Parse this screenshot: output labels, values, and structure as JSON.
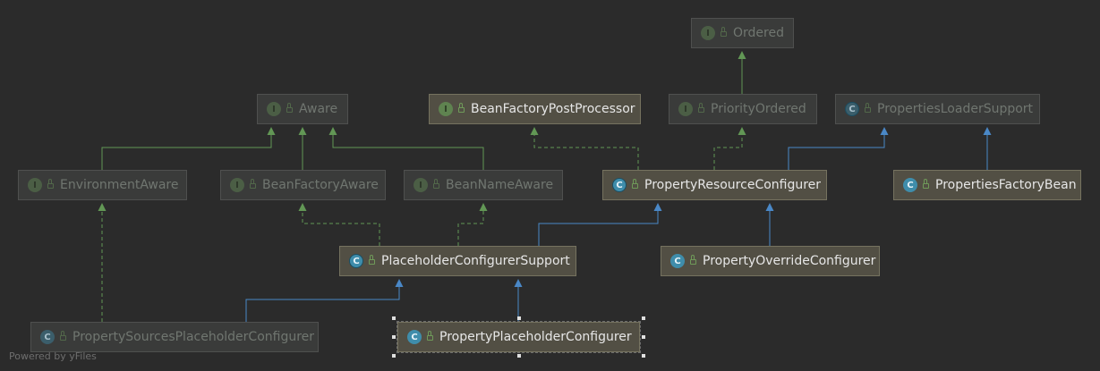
{
  "colors": {
    "background": "#2b2b2b",
    "implements_edge": "#629755",
    "extends_edge": "#4a88c7",
    "selection_handle": "#e0e0e0"
  },
  "nodes": {
    "ordered": {
      "name": "Ordered",
      "kind": "interface",
      "dim": true
    },
    "aware": {
      "name": "Aware",
      "kind": "interface",
      "dim": true
    },
    "bean_factory_post_processor": {
      "name": "BeanFactoryPostProcessor",
      "kind": "interface",
      "dim": false
    },
    "priority_ordered": {
      "name": "PriorityOrdered",
      "kind": "interface",
      "dim": true
    },
    "properties_loader_support": {
      "name": "PropertiesLoaderSupport",
      "kind": "abstract-class",
      "dim": true
    },
    "environment_aware": {
      "name": "EnvironmentAware",
      "kind": "interface",
      "dim": true
    },
    "bean_factory_aware": {
      "name": "BeanFactoryAware",
      "kind": "interface",
      "dim": true
    },
    "bean_name_aware": {
      "name": "BeanNameAware",
      "kind": "interface",
      "dim": true
    },
    "property_resource_configurer": {
      "name": "PropertyResourceConfigurer",
      "kind": "abstract-class",
      "dim": false
    },
    "properties_factory_bean": {
      "name": "PropertiesFactoryBean",
      "kind": "class",
      "dim": false
    },
    "placeholder_configurer_support": {
      "name": "PlaceholderConfigurerSupport",
      "kind": "abstract-class",
      "dim": false
    },
    "property_override_configurer": {
      "name": "PropertyOverrideConfigurer",
      "kind": "class",
      "dim": false
    },
    "property_sources_placeholder_configurer": {
      "name": "PropertySourcesPlaceholderConfigurer",
      "kind": "class",
      "dim": true
    },
    "property_placeholder_configurer": {
      "name": "PropertyPlaceholderConfigurer",
      "kind": "class",
      "dim": false,
      "selected": true
    }
  },
  "badges": {
    "interface": "I",
    "class": "C",
    "abstract-class": "C"
  },
  "icons": {
    "interface": "interface-icon",
    "class": "class-icon",
    "abstract-class": "abstract-class-icon",
    "visibility": "public-lock-icon"
  },
  "edges": [
    {
      "from": "priority_ordered",
      "to": "ordered",
      "relation": "extends-interface"
    },
    {
      "from": "environment_aware",
      "to": "aware",
      "relation": "extends-interface"
    },
    {
      "from": "bean_factory_aware",
      "to": "aware",
      "relation": "extends-interface"
    },
    {
      "from": "bean_name_aware",
      "to": "aware",
      "relation": "extends-interface"
    },
    {
      "from": "property_resource_configurer",
      "to": "bean_factory_post_processor",
      "relation": "implements"
    },
    {
      "from": "property_resource_configurer",
      "to": "priority_ordered",
      "relation": "implements"
    },
    {
      "from": "property_resource_configurer",
      "to": "properties_loader_support",
      "relation": "extends"
    },
    {
      "from": "properties_factory_bean",
      "to": "properties_loader_support",
      "relation": "extends"
    },
    {
      "from": "placeholder_configurer_support",
      "to": "bean_factory_aware",
      "relation": "implements"
    },
    {
      "from": "placeholder_configurer_support",
      "to": "bean_name_aware",
      "relation": "implements"
    },
    {
      "from": "placeholder_configurer_support",
      "to": "property_resource_configurer",
      "relation": "extends"
    },
    {
      "from": "property_override_configurer",
      "to": "property_resource_configurer",
      "relation": "extends"
    },
    {
      "from": "property_sources_placeholder_configurer",
      "to": "environment_aware",
      "relation": "implements"
    },
    {
      "from": "property_sources_placeholder_configurer",
      "to": "placeholder_configurer_support",
      "relation": "extends"
    },
    {
      "from": "property_placeholder_configurer",
      "to": "placeholder_configurer_support",
      "relation": "extends"
    }
  ],
  "footer": "Powered by yFiles"
}
